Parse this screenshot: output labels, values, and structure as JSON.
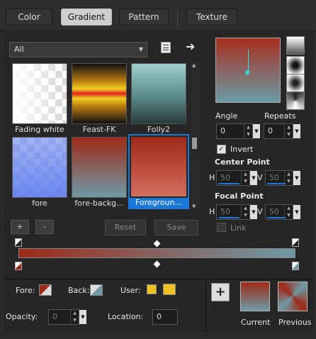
{
  "tabs": [
    {
      "label": "Color"
    },
    {
      "label": "Gradient"
    },
    {
      "label": "Pattern"
    },
    {
      "label": "Texture"
    }
  ],
  "library": {
    "selected": "All"
  },
  "gradients": [
    {
      "name": "Fading white"
    },
    {
      "name": "Feast-FK"
    },
    {
      "name": "Folly2"
    },
    {
      "name": "fore"
    },
    {
      "name": "fore-backg..."
    },
    {
      "name": "Foregroun..."
    }
  ],
  "buttons": {
    "add": "+",
    "remove": "-",
    "reset": "Reset",
    "save": "Save",
    "add_material": "+"
  },
  "angle": {
    "label": "Angle",
    "value": "0"
  },
  "repeats": {
    "label": "Repeats",
    "value": "0"
  },
  "invert": {
    "label": "Invert",
    "checked": true
  },
  "center_point": {
    "label": "Center Point",
    "h_label": "H",
    "h_value": "50",
    "v_label": "V",
    "v_value": "50"
  },
  "focal_point": {
    "label": "Focal Point",
    "h_label": "H",
    "h_value": "50",
    "v_label": "V",
    "v_value": "50"
  },
  "link": {
    "label": "Link",
    "checked": false
  },
  "colors": {
    "fore": "#9e2a18",
    "back": "#6f9aa6",
    "user1": "#f0c020",
    "user2": "#f0c020",
    "selection": "#1a78d8"
  },
  "bottom": {
    "fore_label": "Fore:",
    "back_label": "Back:",
    "user_label": "User:",
    "opacity_label": "Opacity:",
    "opacity_value": "0",
    "location_label": "Location:",
    "location_value": "0",
    "current_label": "Current",
    "previous_label": "Previous"
  }
}
